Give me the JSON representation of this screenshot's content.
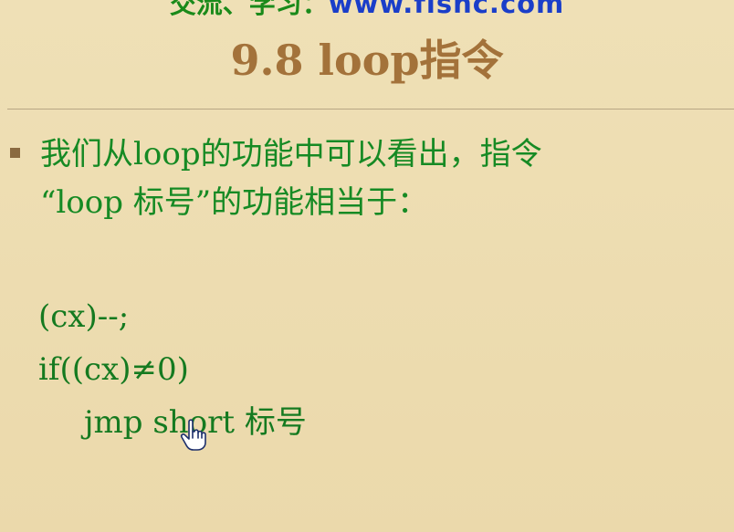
{
  "header": {
    "site_label": "交流、学习：",
    "site_url": "www.fishc.com"
  },
  "slide": {
    "title": "9.8 loop指令",
    "bullet": {
      "line1": "我们从loop的功能中可以看出，指令",
      "line2": "“loop 标号”的功能相当于："
    },
    "code": [
      "(cx)--;",
      "if((cx)≠0)",
      "jmp short 标号"
    ]
  },
  "colors": {
    "background": "#ecdcb0",
    "title": "#a3723a",
    "text": "#168a24",
    "url": "#1a3ec9"
  },
  "icons": {
    "cursor": "hand-pointer-icon"
  }
}
